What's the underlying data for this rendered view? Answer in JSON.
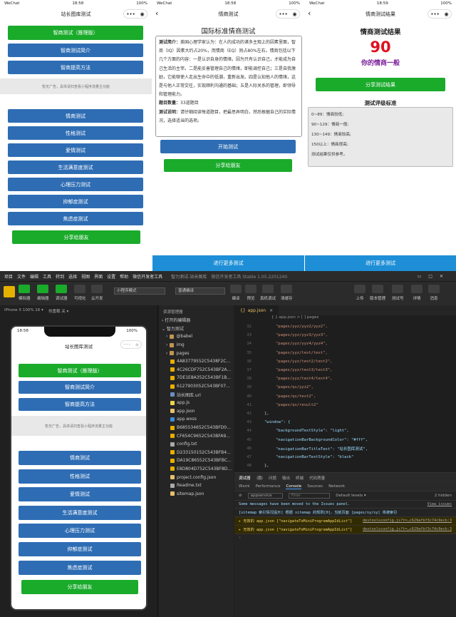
{
  "status": {
    "carrier": "WeChat",
    "battery": "100%"
  },
  "times": [
    "18:58",
    "18:58",
    "18:59"
  ],
  "nav_titles": [
    "站长图库测试",
    "情商测试",
    "情商测试结果"
  ],
  "capsule": {
    "dots": "•••",
    "target": "◉"
  },
  "p1": {
    "top_buttons": [
      "智商测试（推理版）",
      "智商测试简介",
      "智商提高方法"
    ],
    "ad_text": "暂无广告，具体请扫查看小程序流量主功能",
    "list_buttons": [
      "情商测试",
      "性格测试",
      "爱情测试",
      "生活满意度测试",
      "心理压力测试",
      "抑郁症测试",
      "焦虑症测试"
    ],
    "share": "分享给朋友"
  },
  "p2": {
    "title": "国际标准情商测试",
    "intro_label": "测试简介：",
    "intro": "美国心理学家认为：在人的成功的诸多主观上的因素里面，智商（IQ）因素大约占20%，而情商（EQ）则占80%左右。情商包括以下几个方面的内容：一是认识自身的情绪，因为只有认识自己，才能成为自己生活的主宰。二是能妥善管理自己的情绪，即能调控自己；三是自我激励，它能够使人走出生命中的低潮，重新出发。四是认知他人的情绪，这是与他人正常交往，实现顺利沟通的基础；五是人际关系的管理，即领导和管理能力。",
    "count_label": "题目数量：",
    "count": "33道题目",
    "desc_label": "测试说明：",
    "desc": "请仔细阅读每道题目，把最思弄明白，然后根据自己的实际情况，选择适当的选项。",
    "start": "开始测试",
    "share": "分享给朋友",
    "more": "进行更多测试"
  },
  "p3": {
    "title": "情商测试结果",
    "score": "90",
    "verdict": "你的情商一般",
    "share": "分享测试结果",
    "std_title": "测试评级标准",
    "std": [
      "0~89：情商较低;",
      "90~129：情商一般;",
      "130~149：情商较高;",
      "150以上：情商很高;",
      "测试结果仅供参考。"
    ],
    "more": "进行更多测试"
  },
  "ide": {
    "menu": [
      "项目",
      "文件",
      "编辑",
      "工具",
      "转到",
      "选择",
      "视图",
      "界面",
      "设置",
      "帮助",
      "微信开发者工具",
      "智力测试-站长图库",
      "微信开发者工具 Stable 1.05.2201240"
    ],
    "toolbar_left": [
      "模拟器",
      "编辑器",
      "调试器",
      "可视化",
      "云开发"
    ],
    "mode": "小程序模式",
    "compile": "普通编译",
    "toolbar_mid": [
      "编译",
      "预览",
      "真机调试",
      "清缓存"
    ],
    "toolbar_right": [
      "上传",
      "版本管理",
      "测试号",
      "详情",
      "消息"
    ],
    "device": "iPhone X 100% 16 ▾",
    "hotreload": "热重载 关 ▾",
    "explorer_title": "资源管理器",
    "open_editors": "› 打开的编辑器",
    "project": "⌄ 智力测试",
    "files": [
      {
        "name": "@babel",
        "kind": "folder"
      },
      {
        "name": "img",
        "kind": "folder"
      },
      {
        "name": "pages",
        "kind": "folder"
      },
      {
        "name": "4A83779552C5438F2C...",
        "kind": "file"
      },
      {
        "name": "4C26CDF752C543BF2A...",
        "kind": "file"
      },
      {
        "name": "7DE1E8A352C543BF1B...",
        "kind": "file"
      },
      {
        "name": "6127903052C543BF07...",
        "kind": "file"
      },
      {
        "name": "站长图库.url",
        "kind": "url"
      },
      {
        "name": "app.js",
        "kind": "js"
      },
      {
        "name": "app.json",
        "kind": "json"
      },
      {
        "name": "app.wxss",
        "kind": "wxss"
      },
      {
        "name": "B685534652C543BFD0...",
        "kind": "file"
      },
      {
        "name": "CF654C9652C543BFA9...",
        "kind": "file"
      },
      {
        "name": "config.txt",
        "kind": "txt"
      },
      {
        "name": "D233150152C543BFB4...",
        "kind": "file"
      },
      {
        "name": "DA19C86552C543BFBC...",
        "kind": "file"
      },
      {
        "name": "E8D804D752C543BF8D...",
        "kind": "file"
      },
      {
        "name": "project.config.json",
        "kind": "json"
      },
      {
        "name": "Readme.txt",
        "kind": "txt"
      },
      {
        "name": "sitemap.json",
        "kind": "json"
      }
    ],
    "tab": "app.json",
    "breadcrumb": "{ } app.json > [ ] pages",
    "code": [
      {
        "n": "32",
        "t": "\"pages/yyz/yyz2/yyz2\","
      },
      {
        "n": "33",
        "t": "\"pages/yyz/yyz3/yyz3\","
      },
      {
        "n": "34",
        "t": "\"pages/yyz/yyz4/yyz4\","
      },
      {
        "n": "35",
        "t": "\"pages/yyz/test/test\","
      },
      {
        "n": "36",
        "t": "\"pages/yyz/test2/test2\","
      },
      {
        "n": "37",
        "t": "\"pages/yyz/test3/test3\","
      },
      {
        "n": "38",
        "t": "\"pages/yyz/test4/test4\","
      },
      {
        "n": "39",
        "t": "\"pages/qs/yyz2\","
      },
      {
        "n": "40",
        "t": "\"pages/qs/test2\","
      },
      {
        "n": "41",
        "t": "\"pages/qs/result2\""
      },
      {
        "n": "42",
        "t": "],"
      },
      {
        "n": "43",
        "t": "\"window\": {"
      },
      {
        "n": "44",
        "t": "\"backgroundTextStyle\": \"light\","
      },
      {
        "n": "45",
        "t": "\"navigationBarBackgroundColor\": \"#fff\","
      },
      {
        "n": "46",
        "t": "\"navigationBarTitleText\": \"站长图库测试\","
      },
      {
        "n": "47",
        "t": "\"navigationBarTextStyle\": \"black\""
      },
      {
        "n": "48",
        "t": "},"
      }
    ],
    "console_tabs": [
      "调试器",
      "3",
      "问题",
      "输出",
      "终端",
      "代码质量"
    ],
    "dev_tabs": [
      "Wxml",
      "Performance",
      "Console",
      "Sources",
      "Network"
    ],
    "appservice": "appservice",
    "filter": "Filter",
    "levels": "Default levels ▾",
    "hidden": "2 hidden",
    "messages": [
      {
        "text": "Some messages have been moved to the Issues panel.",
        "link": "View issues",
        "level": "info"
      },
      {
        "text": "[sitemap 索引情况提示] 根据 sitemap 的规则[0]，当前页面 [pages/sy/sy] 将被索引",
        "link": "",
        "level": "info"
      },
      {
        "text": "▸ 无效的 app.json [\"navigateToMiniProgramAppIdList\"]",
        "link": "devtoolsconfig.js?t=…c629afbf3c74c9ecb:3",
        "level": "warn"
      },
      {
        "text": "▸ 无效的 app.json [\"navigateToMiniProgramAppIdList\"]",
        "link": "devtoolsconfig.js?t=…c629afbf3c74c9ecb:3",
        "level": "warn"
      }
    ],
    "sim_time": "18:58"
  }
}
